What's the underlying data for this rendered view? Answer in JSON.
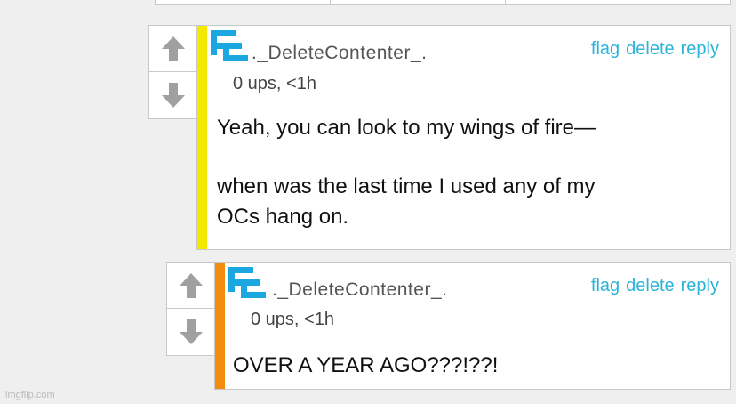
{
  "colors": {
    "accent": "#2bb4d8",
    "avatar_blue": "#1ba8e0",
    "stripe_comment_1": "#f2e800",
    "stripe_comment_2": "#f28c0f",
    "arrow_gray": "#a0a0a0",
    "border": "#c8c8c8"
  },
  "icons": {
    "upvote": "arrow-up-icon",
    "downvote": "arrow-down-icon",
    "avatar": "pixel-avatar-icon"
  },
  "comments": [
    {
      "username": "._DeleteContenter_.",
      "actions": {
        "flag": "flag",
        "delete": "delete",
        "reply": "reply"
      },
      "meta": "0 ups, <1h",
      "paragraphs": [
        "Yeah, you can look to my wings of fire—",
        "when was the last time I used any of my",
        "OCs hang on."
      ]
    },
    {
      "username": "._DeleteContenter_.",
      "actions": {
        "flag": "flag",
        "delete": "delete",
        "reply": "reply"
      },
      "meta": "0 ups, <1h",
      "paragraphs": [
        "OVER A YEAR AGO???!??!"
      ]
    }
  ],
  "watermark": "imgflip.com"
}
